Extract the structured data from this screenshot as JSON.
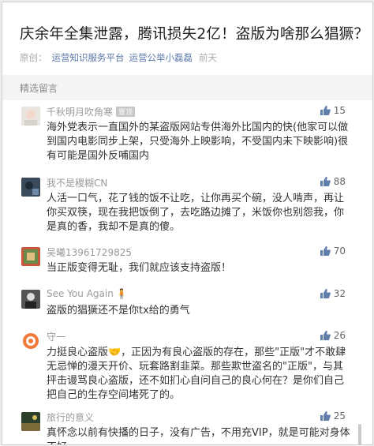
{
  "article": {
    "title": "庆余年全集泄露，腾讯损失2亿！盗版为啥那么猖獗？",
    "source_label": "原创：",
    "author1": "运营知识服务平台",
    "author2": "运营公举小磊磊",
    "time": "前天"
  },
  "section_label": "精选留言",
  "comments": [
    {
      "nick": "千秋明月吹角寒",
      "badge": "置顶",
      "likes": "15",
      "text": "海外党表示一直国外的某盗版网站专供海外比国内的快(他家可以做到国内电影同步上架，只受海外上映影响，不受国内未下映影响)很有可能是国外反哺国内"
    },
    {
      "nick": "我不是稷糊CN",
      "badge": "",
      "likes": "88",
      "text": "人活一口气，花了钱的饭不让吃，让你再买个碗，没人啃声，再让你买双筷，现在我把饭倒了，去吃路边摊了，米饭你也别怨我，你是真的香，我却不是真的傻。"
    },
    {
      "nick": "吴曦13961729825",
      "badge": "",
      "likes": "70",
      "text": "当正版变得无耻，我们就应该支持盗版！"
    },
    {
      "nick": "See You Again",
      "badge": "",
      "likes": "32",
      "text": "盗版的猖獗还不是你tx给的勇气"
    },
    {
      "nick": "守一",
      "badge": "",
      "likes": "26",
      "text": "力挺良心盗版🤝，正因为有良心盗版的存在，那些\"正版\"才不敢肆无忌惮的漫天开价、玩套路割韭菜。那些欺世盗名的\"正版\"，与其抨击谩骂良心盗版，还不如扪心自问自己的良心何在？是你们自己把自己的生存空间堵死了的。"
    },
    {
      "nick": "旅行的意义",
      "badge": "",
      "likes": "25",
      "text": "真怀念以前有快播的日子，没有广告，不用充VIP，就是可能对身体不好"
    }
  ]
}
